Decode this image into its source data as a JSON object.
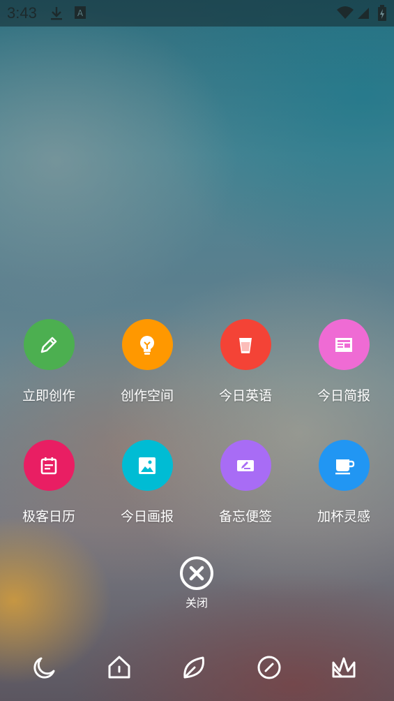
{
  "status_bar": {
    "time": "3:43",
    "icons": [
      "download-icon",
      "a-icon",
      "wifi-icon",
      "signal-icon",
      "battery-icon"
    ]
  },
  "menu": {
    "items": [
      {
        "label": "立即创作",
        "icon": "pencil-icon",
        "color": "#4caf50"
      },
      {
        "label": "创作空间",
        "icon": "lightbulb-icon",
        "color": "#ff9800"
      },
      {
        "label": "今日英语",
        "icon": "cup-icon",
        "color": "#f44336"
      },
      {
        "label": "今日简报",
        "icon": "newspaper-icon",
        "color": "#ef6bd4"
      },
      {
        "label": "极客日历",
        "icon": "calendar-icon",
        "color": "#e91e63"
      },
      {
        "label": "今日画报",
        "icon": "image-icon",
        "color": "#00bcd4"
      },
      {
        "label": "备忘便签",
        "icon": "note-edit-icon",
        "color": "#a86cf5"
      },
      {
        "label": "加杯灵感",
        "icon": "coffee-icon",
        "color": "#2196f3"
      }
    ]
  },
  "close": {
    "label": "关闭",
    "icon": "close-icon"
  },
  "bottom_nav": {
    "items": [
      {
        "icon": "moon-icon"
      },
      {
        "icon": "home-icon"
      },
      {
        "icon": "leaf-icon"
      },
      {
        "icon": "compass-icon"
      },
      {
        "icon": "crown-icon"
      }
    ]
  }
}
